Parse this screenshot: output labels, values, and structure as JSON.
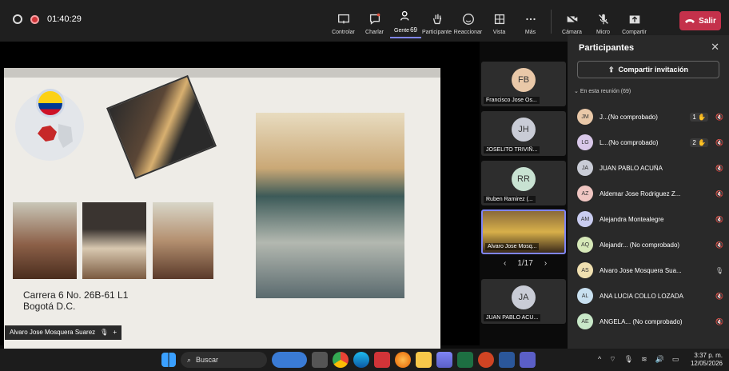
{
  "meeting": {
    "timer": "01:40:29"
  },
  "toolbar": {
    "items": [
      {
        "label": "Controlar"
      },
      {
        "label": "Charlar"
      },
      {
        "label": "Gente",
        "count": "69"
      },
      {
        "label": "Participante"
      },
      {
        "label": "Reaccionar"
      },
      {
        "label": "Vista"
      },
      {
        "label": "Más"
      }
    ],
    "camera_label": "Cámara",
    "mic_label": "Micro",
    "share_label": "Compartir",
    "leave_label": "Salir"
  },
  "slide": {
    "address_line1": "Carrera 6 No. 26B-61 L1",
    "address_line2": "Bogotá D.C."
  },
  "speaker": {
    "name": "Alvaro Jose Mosquera Suarez"
  },
  "tiles": [
    {
      "initials": "FB",
      "name": "Francisco Jose Os...",
      "color": "#e9c8a8"
    },
    {
      "initials": "JH",
      "name": "JOSELITO TRIVIÑ...",
      "color": "#c9ccd6"
    },
    {
      "initials": "RR",
      "name": "Ruben Ramirez (...",
      "color": "#c8e2d2"
    },
    {
      "initials": "",
      "name": "Alvaro Jose Mosq...",
      "color": "#d8b04a"
    },
    {
      "initials": "JA",
      "name": "JUAN PABLO ACU...",
      "color": "#c9ccd6"
    }
  ],
  "pager": {
    "text": "1/17"
  },
  "panel": {
    "title": "Participantes",
    "invite_label": "Compartir invitación",
    "section_label": "En esta reunión (69)",
    "participants": [
      {
        "initials": "JM",
        "name": "J...(No comprobado)",
        "hand": "1",
        "color": "#e9c8a8"
      },
      {
        "initials": "LG",
        "name": "L...(No comprobado)",
        "hand": "2",
        "color": "#d9c8e9"
      },
      {
        "initials": "JA",
        "name": "JUAN PABLO ACUÑA",
        "hand": "",
        "color": "#c9ccd6"
      },
      {
        "initials": "AZ",
        "name": "Aldemar Jose Rodriguez Z...",
        "hand": "",
        "color": "#f0c6c2"
      },
      {
        "initials": "AM",
        "name": "Alejandra Montealegre",
        "hand": "",
        "color": "#c9ccf0"
      },
      {
        "initials": "AQ",
        "name": "Alejandr... (No comprobado)",
        "hand": "",
        "color": "#d6e8b8"
      },
      {
        "initials": "AS",
        "name": "Alvaro Jose Mosquera Sua...",
        "hand": "",
        "color": "#f0e0b0"
      },
      {
        "initials": "AL",
        "name": "ANA LUCIA COLLO LOZADA",
        "hand": "",
        "color": "#c8e0f0"
      },
      {
        "initials": "AE",
        "name": "ANGELA... (No comprobado)",
        "hand": "",
        "color": "#c8e8c8"
      }
    ]
  },
  "taskbar": {
    "search_label": "Buscar",
    "time": "3:37 p. m.",
    "date": "12/05/2026"
  }
}
